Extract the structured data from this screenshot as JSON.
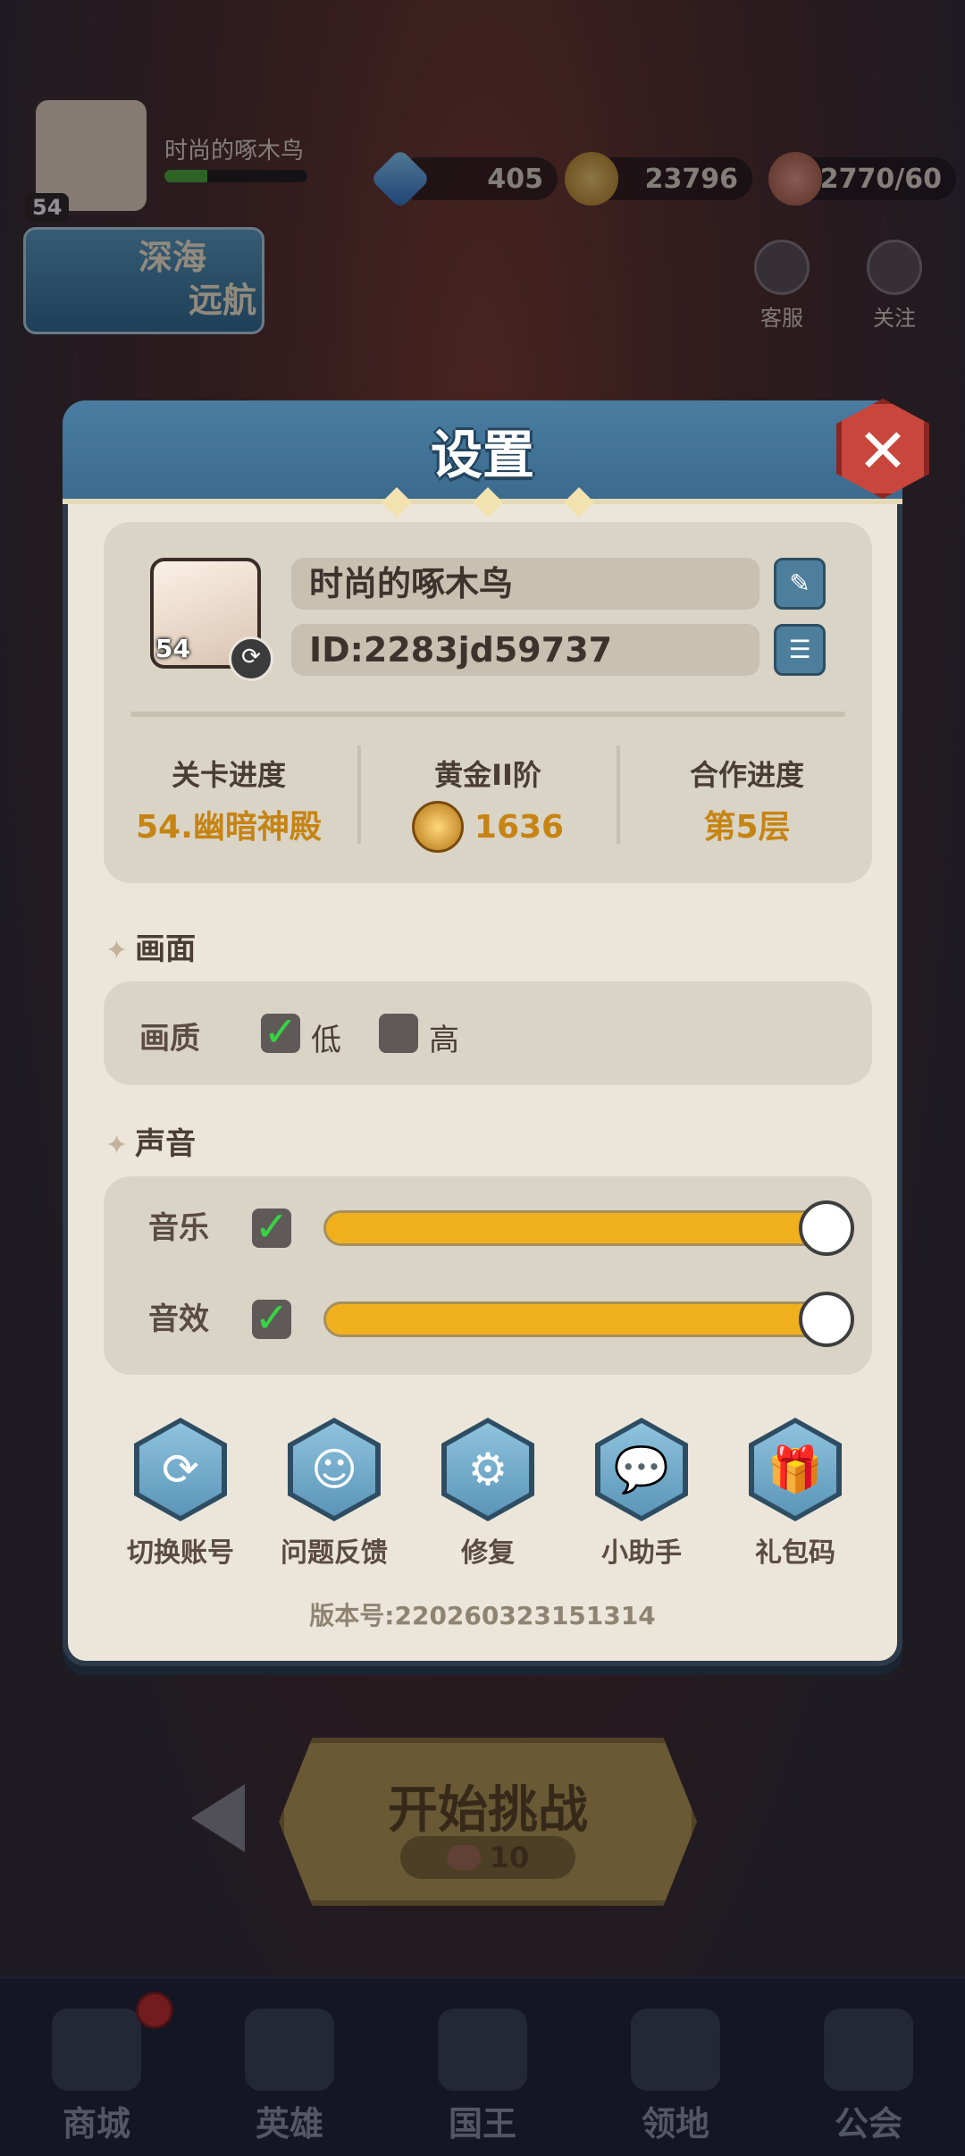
{
  "top_bar": {
    "player_name": "时尚的啄木鸟",
    "player_level": "54",
    "xp_progress": 0.3,
    "diamonds": "405",
    "gold": "23796",
    "stamina": "2770/60"
  },
  "event_banner": {
    "line1": "深海",
    "line2": "远航"
  },
  "top_buttons": {
    "kefu": "客服",
    "guanzhu": "关注"
  },
  "settings": {
    "title": "设置",
    "profile": {
      "name": "时尚的啄木鸟",
      "id": "ID:2283jd59737",
      "level": "54",
      "stats": [
        {
          "label": "关卡进度",
          "value": "54.幽暗神殿"
        },
        {
          "label": "黄金II阶",
          "value": "1636"
        },
        {
          "label": "合作进度",
          "value": "第5层"
        }
      ]
    },
    "graphics": {
      "section_title": "画面",
      "quality_label": "画质",
      "options": [
        {
          "label": "低",
          "checked": true
        },
        {
          "label": "高",
          "checked": false
        }
      ]
    },
    "sound": {
      "section_title": "声音",
      "music": {
        "label": "音乐",
        "enabled": true,
        "level": 1.0
      },
      "sfx": {
        "label": "音效",
        "enabled": true,
        "level": 1.0
      }
    },
    "actions": [
      {
        "label": "切换账号",
        "icon": "refresh-icon"
      },
      {
        "label": "问题反馈",
        "icon": "feedback-icon"
      },
      {
        "label": "修复",
        "icon": "gear-icon"
      },
      {
        "label": "小助手",
        "icon": "wechat-icon"
      },
      {
        "label": "礼包码",
        "icon": "gift-icon"
      }
    ],
    "version": "版本号:220260323151314"
  },
  "start_button": {
    "label": "开始挑战",
    "cost": "10"
  },
  "bottom_nav": [
    {
      "label": "商城",
      "icon": "shop-icon"
    },
    {
      "label": "英雄",
      "icon": "helmet-icon"
    },
    {
      "label": "国王",
      "icon": "crown-icon"
    },
    {
      "label": "领地",
      "icon": "castle-icon"
    },
    {
      "label": "公会",
      "icon": "planet-icon"
    }
  ],
  "colors": {
    "accent_gold": "#c68413",
    "slider_fill": "#f0b01e",
    "header_blue": "#3b6b8f",
    "close_red": "#c9463d",
    "check_green": "#35d443"
  }
}
